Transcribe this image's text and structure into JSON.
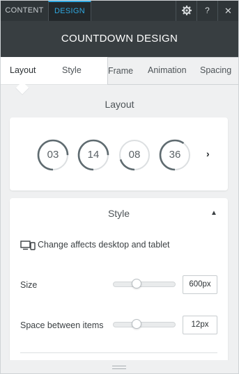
{
  "top_tabs": {
    "content": "CONTENT",
    "design": "DESIGN"
  },
  "top_icons": {
    "settings": "gear-icon",
    "help": "?",
    "close": "✕"
  },
  "title": "COUNTDOWN DESIGN",
  "sub_tabs": [
    "Layout",
    "Style",
    "Frame",
    "Animation",
    "Spacing"
  ],
  "active_sub_tab": "Layout",
  "layout_section": {
    "heading": "Layout",
    "circles": [
      {
        "value": "03",
        "progress": 0.75
      },
      {
        "value": "14",
        "progress": 0.75
      },
      {
        "value": "08",
        "progress": 0.2
      },
      {
        "value": "36",
        "progress": 0.6
      }
    ],
    "next_symbol": "›"
  },
  "style_section": {
    "title": "Style",
    "collapse_symbol": "▲",
    "device_note": "Change affects desktop and tablet",
    "fields": [
      {
        "label": "Size",
        "value": "600px",
        "slider_level": 0.35
      },
      {
        "label": "Space between items",
        "value": "12px",
        "slider_level": 0.35
      }
    ]
  },
  "colors": {
    "accent": "#2fa8e0",
    "topbar": "#2f3538",
    "titlebar": "#383e41",
    "ring": "#5f6b70",
    "ring_track": "#dcdfe1"
  }
}
